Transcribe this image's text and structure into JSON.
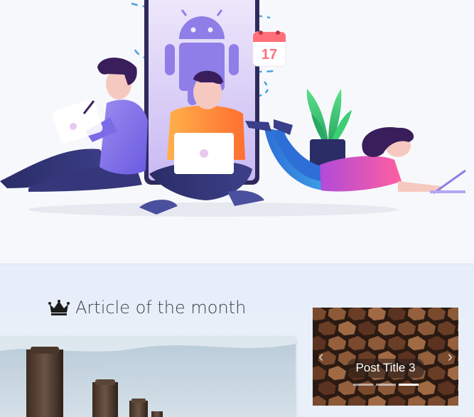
{
  "hero": {
    "illustration": "people-with-devices-illustration",
    "calendar_day": "17"
  },
  "article_of_month": {
    "icon": "crown-icon",
    "heading": "Article of the month",
    "image": "wooden-posts-photo"
  },
  "carousel": {
    "slide_caption": "Post Title 3",
    "image": "stacked-firewood-photo",
    "prev_icon": "chevron-left-icon",
    "next_icon": "chevron-right-icon",
    "slide_count": 3,
    "active_slide": 3
  },
  "colors": {
    "page_bg": "#f7f8fb",
    "section_bg": "#e6eef9",
    "heading_text": "#3a3f47",
    "accent_purple": "#8f7ee8",
    "accent_orange": "#ff8a3d",
    "accent_pink": "#e25ab8"
  }
}
